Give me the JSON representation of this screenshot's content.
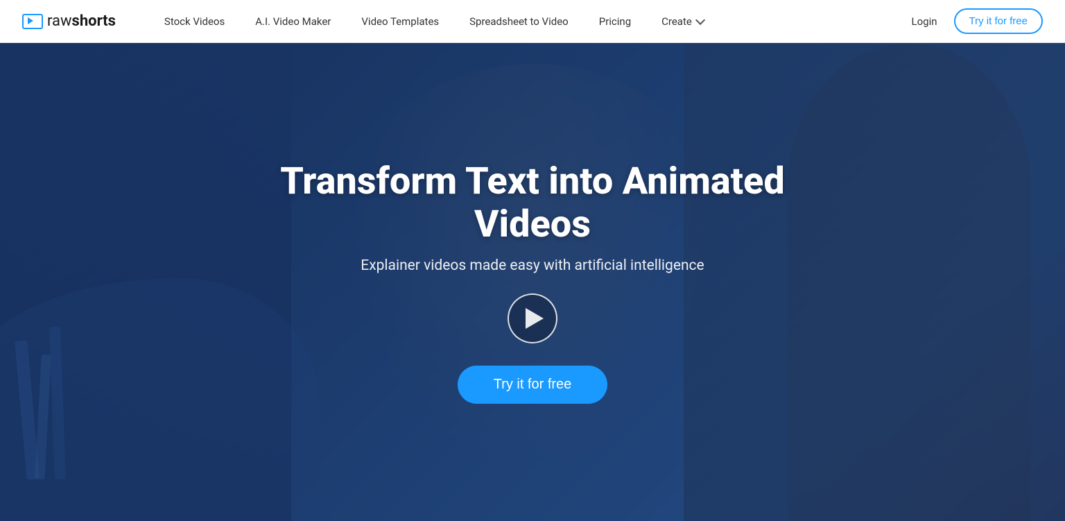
{
  "logo": {
    "text_raw": "raw",
    "text_shorts": "shorts"
  },
  "navbar": {
    "links": [
      {
        "id": "stock-videos",
        "label": "Stock Videos"
      },
      {
        "id": "ai-video-maker",
        "label": "A.I. Video Maker"
      },
      {
        "id": "video-templates",
        "label": "Video Templates"
      },
      {
        "id": "spreadsheet-to-video",
        "label": "Spreadsheet to Video"
      },
      {
        "id": "pricing",
        "label": "Pricing"
      },
      {
        "id": "create",
        "label": "Create"
      }
    ],
    "login_label": "Login",
    "try_free_label": "Try it for free"
  },
  "hero": {
    "title": "Transform Text into Animated Videos",
    "subtitle": "Explainer videos made easy with artificial intelligence",
    "play_button_label": "Play video",
    "try_free_label": "Try it for free"
  }
}
